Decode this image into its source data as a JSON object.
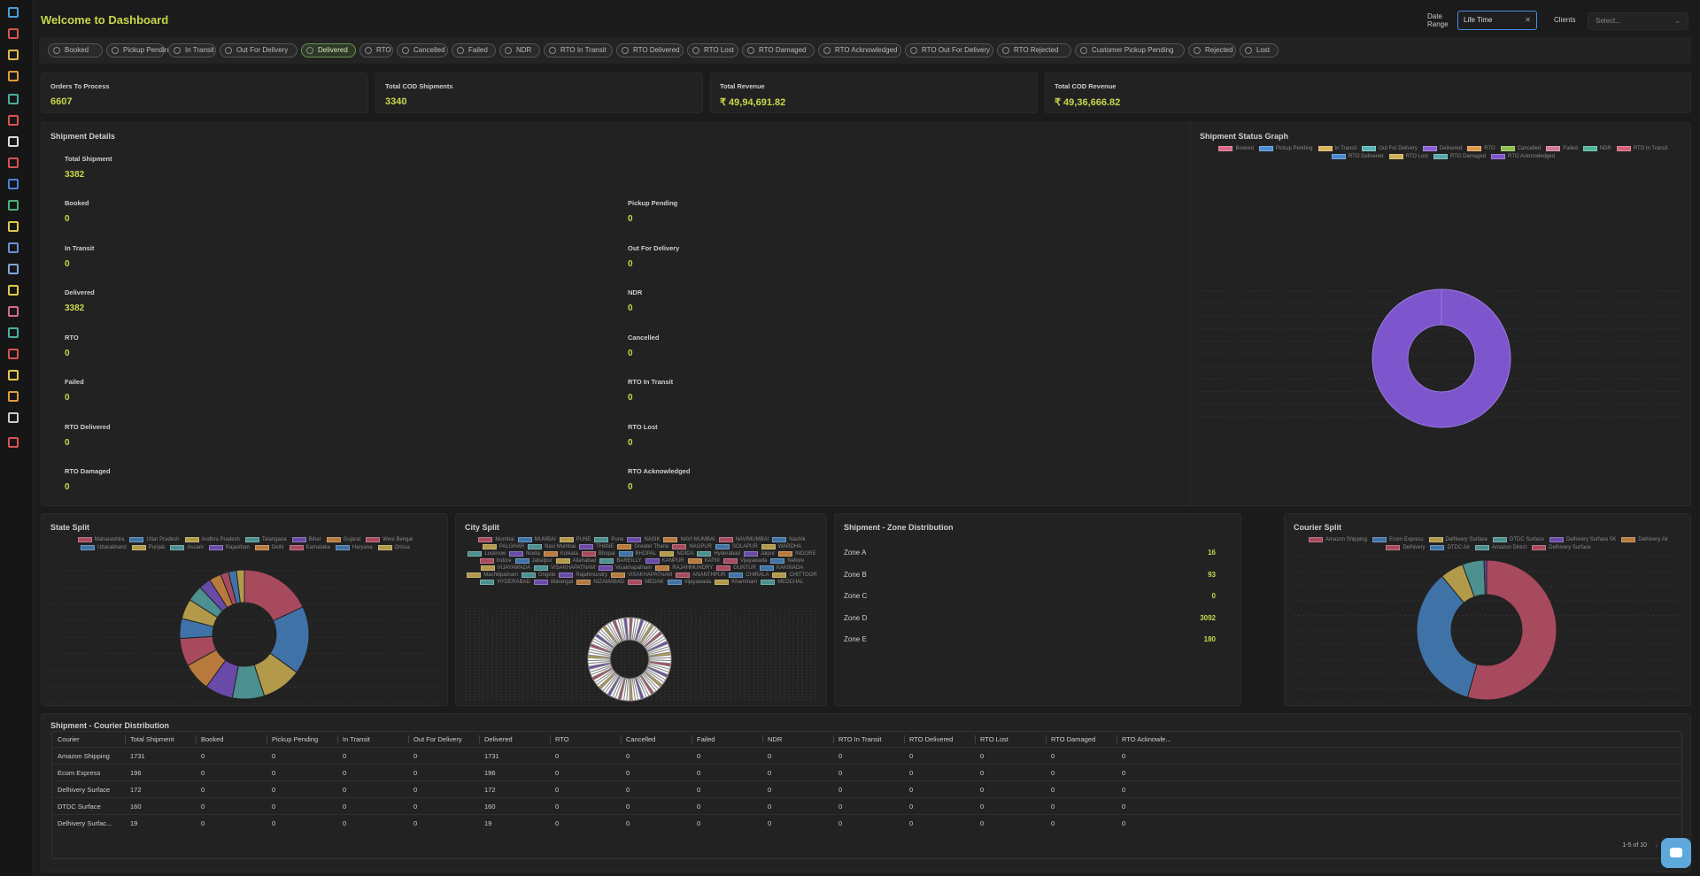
{
  "header": {
    "title": "Welcome to Dashboard",
    "date_range_label": "Date Range",
    "date_range_value": "Life Time",
    "clients_label": "Clients",
    "clients_placeholder": "Select..."
  },
  "sidebar_icons": [
    "dashboard-icon",
    "orders-icon",
    "box-icon",
    "truck-icon",
    "analytics-icon",
    "target-icon",
    "card-icon",
    "shield-icon",
    "documents-icon",
    "money-icon",
    "user-icon",
    "users-icon",
    "file-icon",
    "calculator-icon",
    "cloud-icon",
    "building-icon",
    "package-icon",
    "warehouse-icon",
    "store-icon",
    "settings-icon",
    "logout-icon"
  ],
  "filters": [
    "Booked",
    "Pickup Pending",
    "In Transit",
    "Out For Delivery",
    "Delivered",
    "RTO",
    "Cancelled",
    "Failed",
    "NDR",
    "RTO In Transit",
    "RTO Delivered",
    "RTO Lost",
    "RTO Damaged",
    "RTO Acknowledged",
    "RTO Out For Delivery",
    "RTO Rejected",
    "Customer Pickup Pending",
    "Rejected",
    "Lost"
  ],
  "active_filter": "Delivered",
  "summary_cards": [
    {
      "label": "Orders To Process",
      "value": "6607"
    },
    {
      "label": "Total COD Shipments",
      "value": "3340"
    },
    {
      "label": "Total Revenue",
      "value": "₹ 49,94,691.82"
    },
    {
      "label": "Total COD Revenue",
      "value": "₹ 49,36,666.82"
    }
  ],
  "shipment_details": {
    "title": "Shipment Details",
    "total_label": "Total Shipment",
    "total_value": "3382",
    "left": [
      {
        "label": "Booked",
        "value": "0"
      },
      {
        "label": "In Transit",
        "value": "0"
      },
      {
        "label": "Delivered",
        "value": "3382"
      },
      {
        "label": "RTO",
        "value": "0"
      },
      {
        "label": "Failed",
        "value": "0"
      },
      {
        "label": "RTO Delivered",
        "value": "0"
      },
      {
        "label": "RTO Damaged",
        "value": "0"
      }
    ],
    "right": [
      {
        "label": "Pickup Pending",
        "value": "0"
      },
      {
        "label": "Out For Delivery",
        "value": "0"
      },
      {
        "label": "NDR",
        "value": "0"
      },
      {
        "label": "Cancelled",
        "value": "0"
      },
      {
        "label": "RTO In Transit",
        "value": "0"
      },
      {
        "label": "RTO Lost",
        "value": "0"
      },
      {
        "label": "RTO Acknowledged",
        "value": "0"
      }
    ]
  },
  "status_graph": {
    "title": "Shipment Status Graph",
    "legend": [
      {
        "name": "Booked",
        "color": "#d96a87"
      },
      {
        "name": "Pickup Pending",
        "color": "#4d8fd6"
      },
      {
        "name": "In Transit",
        "color": "#d9b45a"
      },
      {
        "name": "Out For Delivery",
        "color": "#5bb3b3"
      },
      {
        "name": "Delivered",
        "color": "#8a5fd6"
      },
      {
        "name": "RTO",
        "color": "#e0984c"
      },
      {
        "name": "Cancelled",
        "color": "#8fbf4d"
      },
      {
        "name": "Failed",
        "color": "#d07a9a"
      },
      {
        "name": "NDR",
        "color": "#4fb69a"
      },
      {
        "name": "RTO In Transit",
        "color": "#d9607a"
      },
      {
        "name": "RTO Delivered",
        "color": "#4a88cf"
      },
      {
        "name": "RTO Lost",
        "color": "#cfae55"
      },
      {
        "name": "RTO Damaged",
        "color": "#55a9a9"
      },
      {
        "name": "RTO Acknowledged",
        "color": "#7d55cc"
      }
    ]
  },
  "state_split": {
    "title": "State Split",
    "legend": [
      {
        "name": "Maharashtra",
        "color": "#a84a5e"
      },
      {
        "name": "Uttar Pradesh",
        "color": "#3f73a8"
      },
      {
        "name": "Andhra Pradesh",
        "color": "#b39a4a"
      },
      {
        "name": "Telangana",
        "color": "#4c9090"
      },
      {
        "name": "Bihar",
        "color": "#6a4aa8"
      },
      {
        "name": "Gujarat",
        "color": "#b87a3c"
      },
      {
        "name": "West Bengal",
        "color": "#a84a5e"
      },
      {
        "name": "Uttarakhand",
        "color": "#3f73a8"
      },
      {
        "name": "Punjab",
        "color": "#b39a4a"
      },
      {
        "name": "Assam",
        "color": "#4c9090"
      },
      {
        "name": "Rajasthan",
        "color": "#6a4aa8"
      },
      {
        "name": "Delhi",
        "color": "#b87a3c"
      },
      {
        "name": "Karnataka",
        "color": "#a84a5e"
      },
      {
        "name": "Haryana",
        "color": "#3f73a8"
      },
      {
        "name": "Orissa",
        "color": "#b39a4a"
      }
    ]
  },
  "city_split": {
    "title": "City Split",
    "legend": [
      {
        "name": "Mumbai",
        "color": "#a84a5e"
      },
      {
        "name": "MUMBAI",
        "color": "#3f73a8"
      },
      {
        "name": "PUNE",
        "color": "#b39a4a"
      },
      {
        "name": "Pune",
        "color": "#4c9090"
      },
      {
        "name": "NASIK",
        "color": "#6a4aa8"
      },
      {
        "name": "NAVI MUMBAI",
        "color": "#b87a3c"
      },
      {
        "name": "NAVIMUMBAI",
        "color": "#a84a5e"
      },
      {
        "name": "Nashik",
        "color": "#3f73a8"
      },
      {
        "name": "PALGHAR",
        "color": "#b39a4a"
      },
      {
        "name": "Navi Mumbai",
        "color": "#4c9090"
      },
      {
        "name": "THANE",
        "color": "#6a4aa8"
      },
      {
        "name": "Greater Thane",
        "color": "#b87a3c"
      },
      {
        "name": "NAGPUR",
        "color": "#a84a5e"
      },
      {
        "name": "SOLAPUR",
        "color": "#3f73a8"
      },
      {
        "name": "WARDHA",
        "color": "#b39a4a"
      },
      {
        "name": "Lucknow",
        "color": "#4c9090"
      },
      {
        "name": "Noida",
        "color": "#6a4aa8"
      },
      {
        "name": "Kolkata",
        "color": "#b87a3c"
      },
      {
        "name": "Bhopal",
        "color": "#a84a5e"
      },
      {
        "name": "BHOPAL",
        "color": "#3f73a8"
      },
      {
        "name": "NOIDA",
        "color": "#b39a4a"
      },
      {
        "name": "Hyderabad",
        "color": "#4c9090"
      },
      {
        "name": "Jaipur",
        "color": "#6a4aa8"
      },
      {
        "name": "INDORE",
        "color": "#b87a3c"
      },
      {
        "name": "Indore",
        "color": "#a84a5e"
      },
      {
        "name": "Jabalpur",
        "color": "#3f73a8"
      },
      {
        "name": "Allahabad",
        "color": "#b39a4a"
      },
      {
        "name": "BAREILLY",
        "color": "#4c9090"
      },
      {
        "name": "KANPUR",
        "color": "#6a4aa8"
      },
      {
        "name": "KATNI",
        "color": "#b87a3c"
      },
      {
        "name": "Vijayawada",
        "color": "#a84a5e"
      },
      {
        "name": "Nellore",
        "color": "#3f73a8"
      },
      {
        "name": "VIJAYAWADA",
        "color": "#b39a4a"
      },
      {
        "name": "VISAKHAPATNAM",
        "color": "#4c9090"
      },
      {
        "name": "Visakhapatnam",
        "color": "#6a4aa8"
      },
      {
        "name": "RAJAHMUNDRY",
        "color": "#b87a3c"
      },
      {
        "name": "GUNTUR",
        "color": "#a84a5e"
      },
      {
        "name": "KAKINADA",
        "color": "#3f73a8"
      },
      {
        "name": "Machilipatnam",
        "color": "#b39a4a"
      },
      {
        "name": "Ongole",
        "color": "#4c9090"
      },
      {
        "name": "Rajahmundry",
        "color": "#6a4aa8"
      },
      {
        "name": "VISAKHAPATNAM",
        "color": "#b87a3c"
      },
      {
        "name": "ANANTHPUR",
        "color": "#a84a5e"
      },
      {
        "name": "CHIRALA",
        "color": "#3f73a8"
      },
      {
        "name": "CHITTOOR",
        "color": "#b39a4a"
      },
      {
        "name": "HYDERABAD",
        "color": "#4c9090"
      },
      {
        "name": "Warangal",
        "color": "#6a4aa8"
      },
      {
        "name": "NIZAMABAD",
        "color": "#b87a3c"
      },
      {
        "name": "MEDAK",
        "color": "#a84a5e"
      },
      {
        "name": "Vijayawada",
        "color": "#3f73a8"
      },
      {
        "name": "Khammam",
        "color": "#b39a4a"
      },
      {
        "name": "MEDCHAL",
        "color": "#4c9090"
      }
    ]
  },
  "zone_distribution": {
    "title": "Shipment - Zone Distribution",
    "zones": [
      {
        "label": "Zone A",
        "value": "16"
      },
      {
        "label": "Zone B",
        "value": "93"
      },
      {
        "label": "Zone C",
        "value": "0"
      },
      {
        "label": "Zone D",
        "value": "3092"
      },
      {
        "label": "Zone E",
        "value": "180"
      }
    ]
  },
  "courier_split": {
    "title": "Courier Split",
    "legend": [
      {
        "name": "Amazon Shipping",
        "color": "#a84a5e"
      },
      {
        "name": "Ecom Express",
        "color": "#3f73a8"
      },
      {
        "name": "Delhivery Surface",
        "color": "#b39a4a"
      },
      {
        "name": "DTDC Surface",
        "color": "#4c9090"
      },
      {
        "name": "Delhivery Surface 5K",
        "color": "#6a4aa8"
      },
      {
        "name": "Delhivery Air",
        "color": "#b87a3c"
      },
      {
        "name": "Delhivery",
        "color": "#a84a5e"
      },
      {
        "name": "DTDC Air",
        "color": "#3f73a8"
      },
      {
        "name": "Amazon Direct",
        "color": "#4c9090"
      },
      {
        "name": "Delhivery Surface",
        "color": "#a84a5e"
      }
    ]
  },
  "courier_table": {
    "title": "Shipment - Courier Distribution",
    "columns": [
      "Courier",
      "Total Shipment",
      "Booked",
      "Pickup Pending",
      "In Transit",
      "Out For Delivery",
      "Delivered",
      "RTO",
      "Cancelled",
      "Failed",
      "NDR",
      "RTO In Transit",
      "RTO Delivered",
      "RTO Lost",
      "RTO Damaged",
      "RTO Acknowle..."
    ],
    "rows": [
      [
        "Amazon Shipping",
        "1731",
        "0",
        "0",
        "0",
        "0",
        "1731",
        "0",
        "0",
        "0",
        "0",
        "0",
        "0",
        "0",
        "0",
        "0"
      ],
      [
        "Ecom Express",
        "196",
        "0",
        "0",
        "0",
        "0",
        "196",
        "0",
        "0",
        "0",
        "0",
        "0",
        "0",
        "0",
        "0",
        "0"
      ],
      [
        "Delhivery Surface",
        "172",
        "0",
        "0",
        "0",
        "0",
        "172",
        "0",
        "0",
        "0",
        "0",
        "0",
        "0",
        "0",
        "0",
        "0"
      ],
      [
        "DTDC Surface",
        "160",
        "0",
        "0",
        "0",
        "0",
        "160",
        "0",
        "0",
        "0",
        "0",
        "0",
        "0",
        "0",
        "0",
        "0"
      ],
      [
        "Delhivery Surfac...",
        "19",
        "0",
        "0",
        "0",
        "0",
        "19",
        "0",
        "0",
        "0",
        "0",
        "0",
        "0",
        "0",
        "0",
        "0"
      ]
    ],
    "pagination": "1-5 of 10"
  },
  "chart_data": [
    {
      "type": "pie",
      "categories": [
        "Delivered"
      ],
      "values": [
        3382
      ]
    },
    {
      "type": "pie",
      "categories": [
        "Maharashtra",
        "Uttar Pradesh",
        "Andhra Pradesh",
        "Telangana",
        "Bihar",
        "Gujarat",
        "West Bengal",
        "Uttarakhand",
        "Punjab",
        "Assam",
        "Rajasthan",
        "Delhi",
        "Karnataka",
        "Haryana",
        "Orissa"
      ],
      "values": [
        18,
        17,
        10,
        8,
        7,
        7,
        7,
        5,
        5,
        4,
        3,
        3,
        2,
        2,
        2
      ]
    },
    {
      "type": "pie",
      "categories": [
        "Amazon Shipping",
        "Ecom Express",
        "Delhivery Surface",
        "DTDC Surface",
        "Delhivery Surface 5K"
      ],
      "values": [
        1731,
        1100,
        172,
        160,
        19
      ]
    }
  ]
}
